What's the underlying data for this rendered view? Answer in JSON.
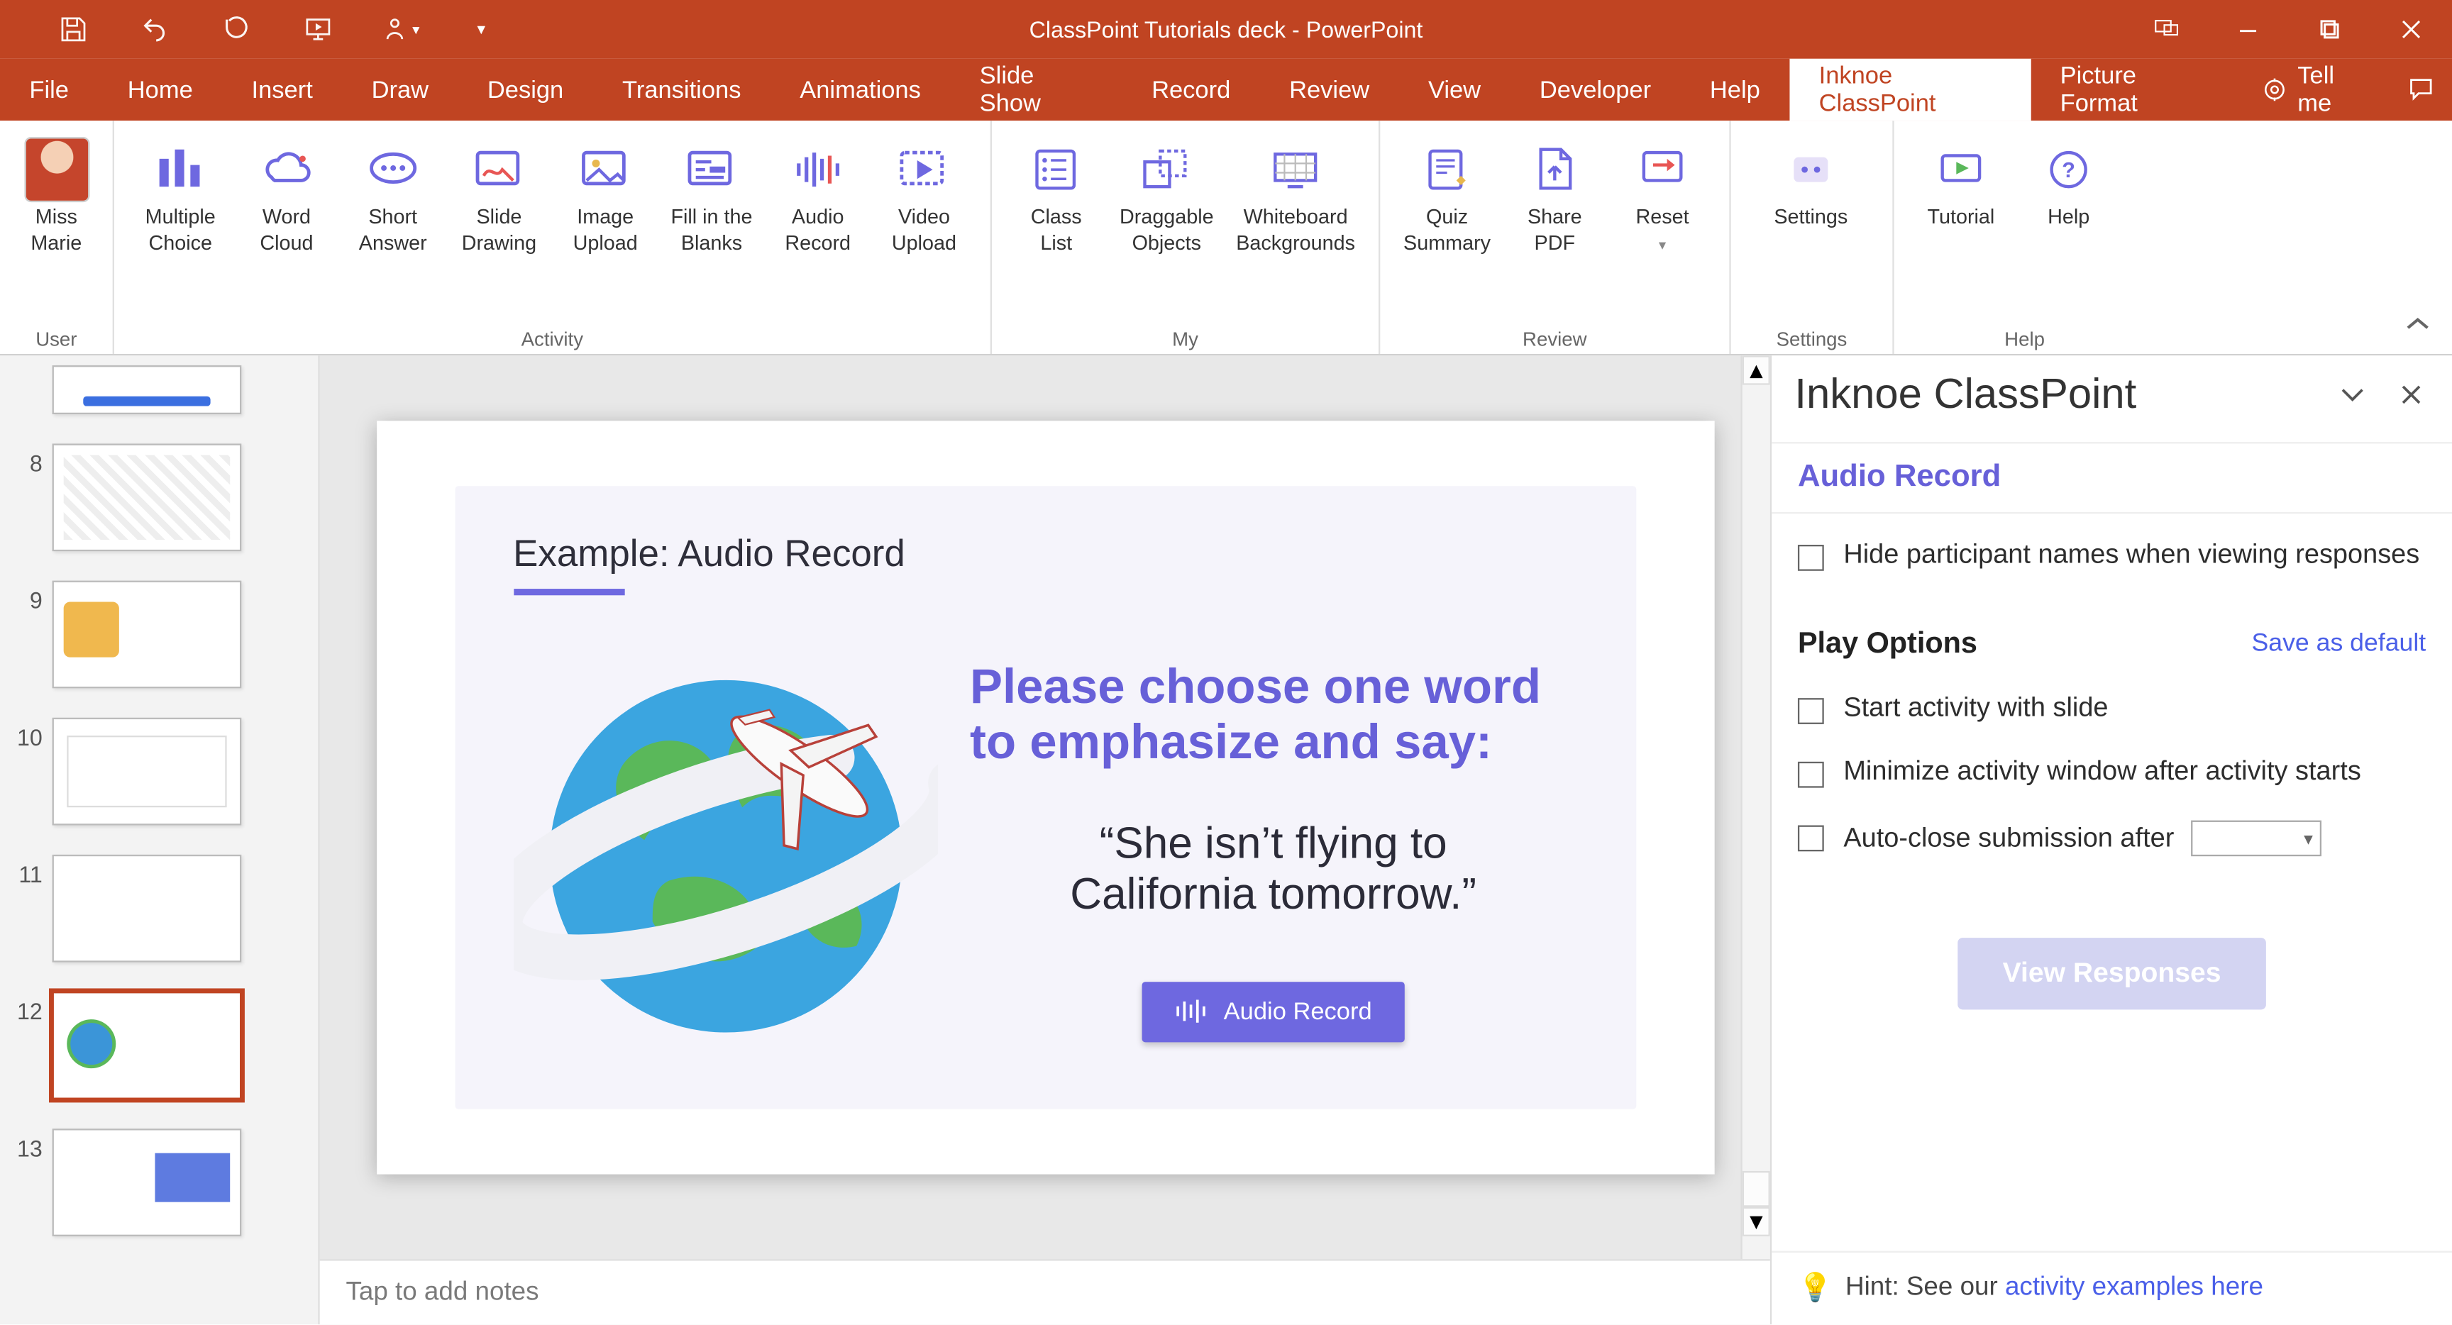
{
  "app_title": "ClassPoint Tutorials deck  -  PowerPoint",
  "tabs": [
    "File",
    "Home",
    "Insert",
    "Draw",
    "Design",
    "Transitions",
    "Animations",
    "Slide Show",
    "Record",
    "Review",
    "View",
    "Developer",
    "Help",
    "Inknoe ClassPoint",
    "Picture Format"
  ],
  "active_tab": "Inknoe ClassPoint",
  "tell_me": "Tell me",
  "ribbon": {
    "user": {
      "name_line1": "Miss",
      "name_line2": "Marie",
      "group": "User"
    },
    "activity": {
      "group": "Activity",
      "items": [
        {
          "l1": "Multiple",
          "l2": "Choice"
        },
        {
          "l1": "Word",
          "l2": "Cloud"
        },
        {
          "l1": "Short",
          "l2": "Answer"
        },
        {
          "l1": "Slide",
          "l2": "Drawing"
        },
        {
          "l1": "Image",
          "l2": "Upload"
        },
        {
          "l1": "Fill in the",
          "l2": "Blanks"
        },
        {
          "l1": "Audio",
          "l2": "Record"
        },
        {
          "l1": "Video",
          "l2": "Upload"
        }
      ]
    },
    "my": {
      "group": "My",
      "items": [
        {
          "l1": "Class",
          "l2": "List"
        },
        {
          "l1": "Draggable",
          "l2": "Objects"
        },
        {
          "l1": "Whiteboard",
          "l2": "Backgrounds"
        }
      ]
    },
    "review": {
      "group": "Review",
      "items": [
        {
          "l1": "Quiz",
          "l2": "Summary"
        },
        {
          "l1": "Share",
          "l2": "PDF"
        },
        {
          "l1": "Reset",
          "l2": ""
        }
      ]
    },
    "settings": {
      "group": "Settings",
      "items": [
        {
          "l1": "Settings",
          "l2": ""
        }
      ]
    },
    "help": {
      "group": "Help",
      "items": [
        {
          "l1": "Tutorial",
          "l2": ""
        },
        {
          "l1": "Help",
          "l2": ""
        }
      ]
    }
  },
  "thumbnails": {
    "visible": [
      "8",
      "9",
      "10",
      "11",
      "12",
      "13"
    ],
    "selected": "12"
  },
  "slide": {
    "heading": "Example: Audio Record",
    "prompt_line1": "Please choose one word",
    "prompt_line2": "to emphasize and say:",
    "quote_line1": "“She isn’t flying to",
    "quote_line2": "California tomorrow.”",
    "button_label": "Audio Record"
  },
  "notes_placeholder": "Tap to add notes",
  "panel": {
    "title": "Inknoe ClassPoint",
    "subtitle": "Audio Record",
    "opt_hide_names": "Hide participant names when viewing responses",
    "section_play": "Play Options",
    "save_default": "Save as default",
    "opt_start": "Start activity with slide",
    "opt_minimize": "Minimize activity window after activity starts",
    "opt_autoclose": "Auto-close submission after",
    "view_responses": "View Responses",
    "hint_prefix": "Hint: See our ",
    "hint_link": "activity examples here"
  }
}
